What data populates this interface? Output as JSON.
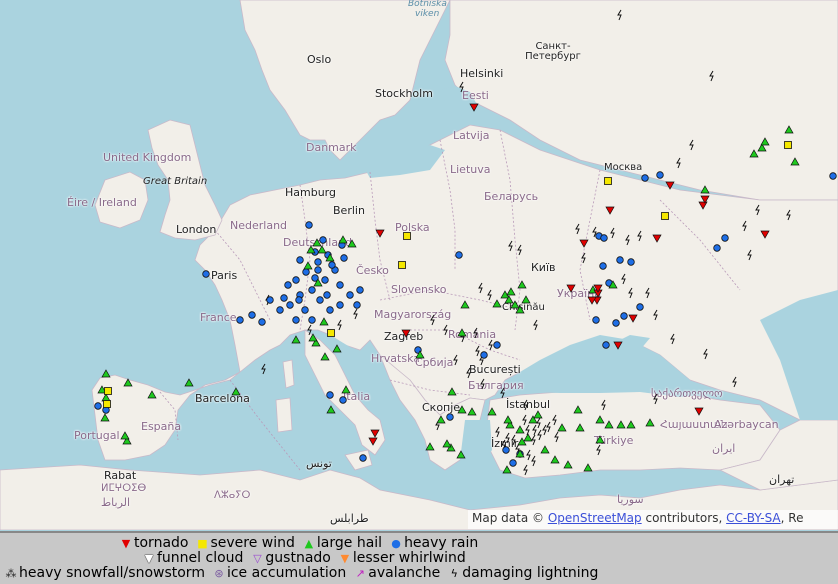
{
  "attribution": {
    "prefix": "Map data ©",
    "osm": "OpenStreetMap",
    "mid": "contributors,",
    "license": "CC-BY-SA",
    "tail": ", Re"
  },
  "legend": {
    "row1": [
      {
        "sym": "▼",
        "color": "#e00000",
        "label": "tornado",
        "key": "tornado-icon"
      },
      {
        "sym": "■",
        "color": "#f5e800",
        "label": "severe wind",
        "key": "severe-wind-icon"
      },
      {
        "sym": "▲",
        "color": "#1ec81e",
        "label": "large hail",
        "key": "large-hail-icon"
      },
      {
        "sym": "●",
        "color": "#1e6ee6",
        "label": "heavy rain",
        "key": "heavy-rain-icon"
      }
    ],
    "row2": [
      {
        "sym": "▼",
        "color": "#ffffff",
        "label": "funnel cloud",
        "key": "funnel-cloud-icon"
      },
      {
        "sym": "▽",
        "color": "#9a4ad0",
        "label": "gustnado",
        "key": "gustnado-icon"
      },
      {
        "sym": "▼",
        "color": "#ff8a30",
        "label": "lesser whirlwind",
        "key": "lesser-whirlwind-icon"
      }
    ],
    "row3": [
      {
        "sym": "⁂",
        "color": "#222222",
        "label": "heavy snowfall/snowstorm",
        "key": "snowfall-icon"
      },
      {
        "sym": "⊛",
        "color": "#7a5aa0",
        "label": "ice accumulation",
        "key": "ice-icon"
      },
      {
        "sym": "↗",
        "color": "#c020c0",
        "label": "avalanche",
        "key": "avalanche-icon"
      },
      {
        "sym": "ϟ",
        "color": "#000000",
        "label": "damaging lightning",
        "key": "lightning-icon"
      }
    ]
  },
  "labels": {
    "oslo": "Oslo",
    "stockholm": "Stockholm",
    "helsinki": "Helsinki",
    "spb": "Санкт-Петербург",
    "eesti": "Eesti",
    "latvija": "Latvija",
    "lietuva": "Lietuva",
    "moskva": "Москва",
    "belarus": "Беларусь",
    "danmark": "Danmark",
    "uk": "United Kingdom",
    "gb": "Great Britain",
    "eire": "Éire / Ireland",
    "london": "London",
    "hamburg": "Hamburg",
    "berlin": "Berlin",
    "nederland": "Nederland",
    "deutschland": "Deutschland",
    "polska": "Polska",
    "cesko": "Česko",
    "kyiv": "Київ",
    "paris": "Paris",
    "slovensko": "Slovensko",
    "ukraina": "Україна",
    "france": "France",
    "magyar": "Magyarország",
    "chisinau": "Chișinău",
    "romania": "România",
    "zagreb": "Zagreb",
    "hrvatska": "Hrvatska",
    "srbija": "Србија",
    "bucuresti": "București",
    "bulgaria": "България",
    "italia": "Italia",
    "barcelona": "Barcelona",
    "espana": "España",
    "portugal": "Portugal",
    "skopje": "Скопје",
    "istanbul": "İstanbul",
    "izmir": "İzmir",
    "turkiye": "Türkiye",
    "sakartvelo": "საქართველო",
    "hayastan": "Հայաստան",
    "azerbaycan": "Azərbaycan",
    "tunis": "تونس",
    "rabat": "Rabat",
    "morocco1": "ⵍⵎⵖⵔⵉⴱ",
    "morocco2": "الرباط",
    "algeria": "ⴷⵣⴰⵢⵔ",
    "tripoli": "طرابلس",
    "syria": "سوريا",
    "iran1": "ایران",
    "tehran": "تهران",
    "baltic1": "Botniska",
    "baltic2": "viken"
  },
  "icon_colors": {
    "tornado": "#e00000",
    "wind": "#f5e800",
    "hail": "#1ec81e",
    "rain": "#1e6ee6"
  }
}
